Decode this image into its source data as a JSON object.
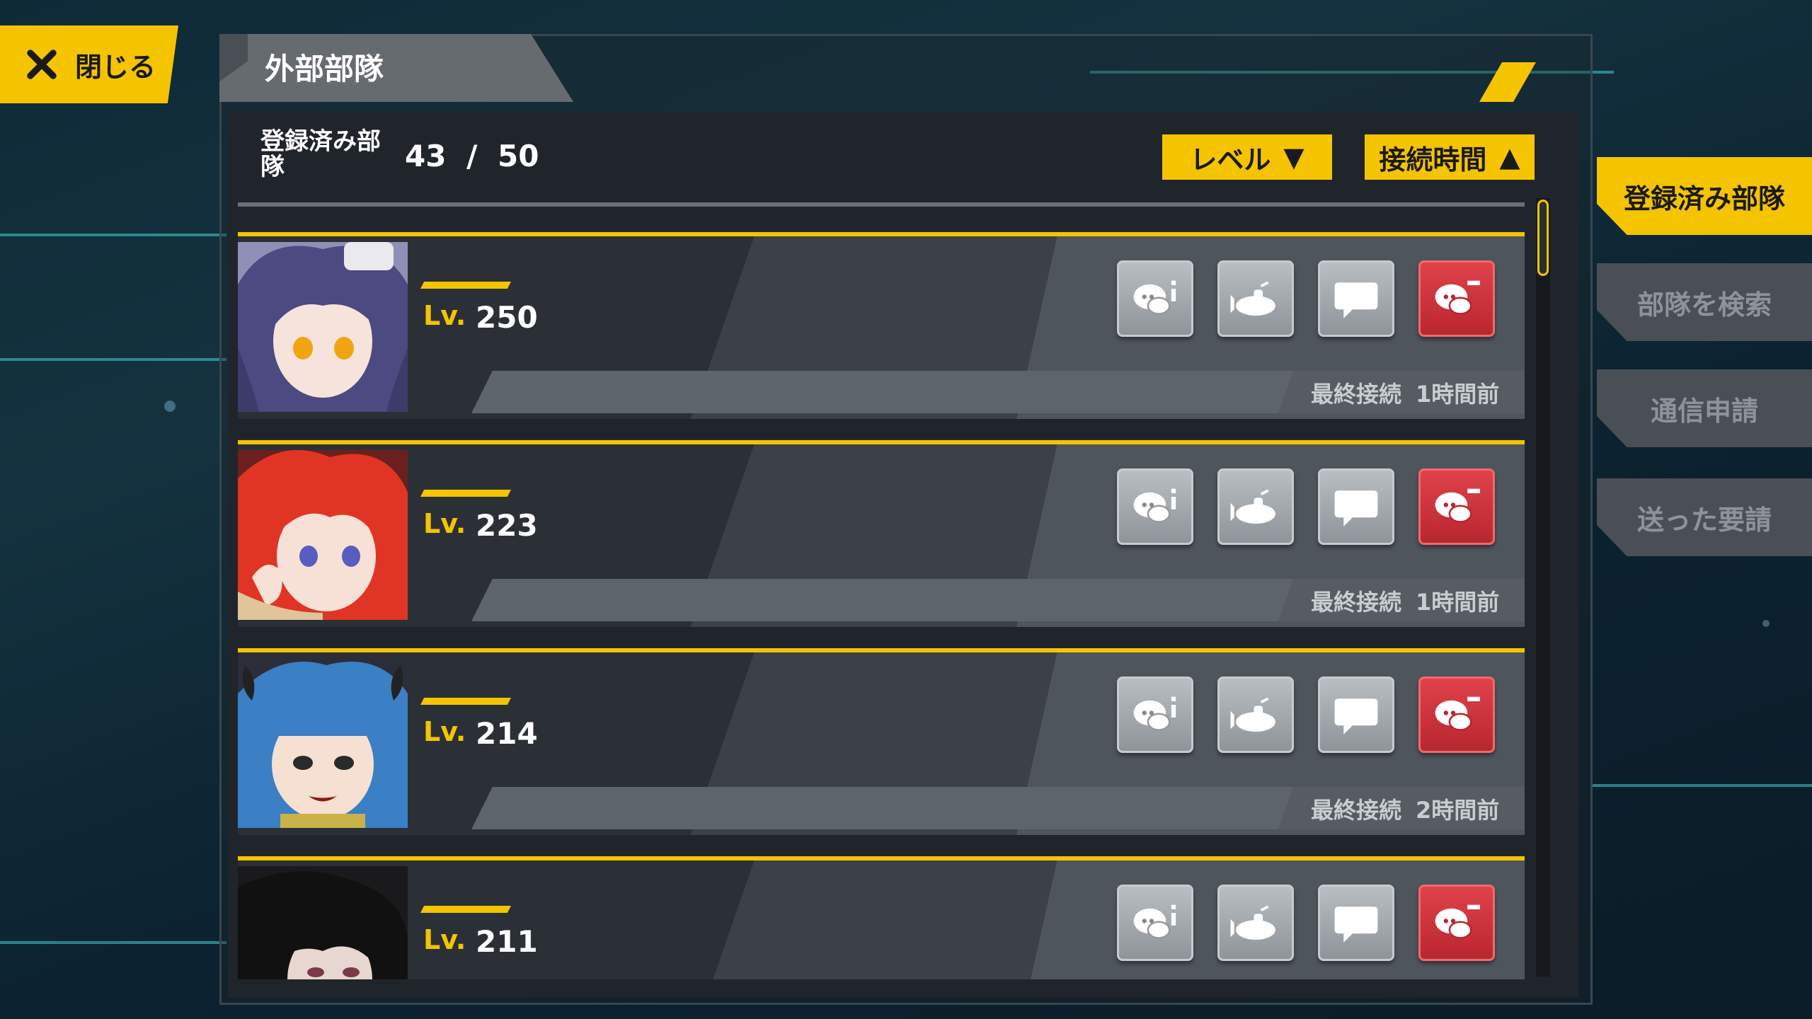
{
  "close_button": {
    "label": "閉じる"
  },
  "panel": {
    "title": "外部部隊"
  },
  "header": {
    "registered_label": "登録済み部隊",
    "registered_count": "43",
    "separator": "/",
    "registered_max": "50",
    "sort_level": "レベル",
    "sort_level_arrow": "▼",
    "sort_time": "接続時間",
    "sort_time_arrow": "▲"
  },
  "rows": [
    {
      "level_label": "Lv.",
      "level": "250",
      "last_login_label": "最終接続",
      "last_login_time": "1時間前",
      "portrait": "purple-hair-maid"
    },
    {
      "level_label": "Lv.",
      "level": "223",
      "last_login_label": "最終接続",
      "last_login_time": "1時間前",
      "portrait": "red-hair"
    },
    {
      "level_label": "Lv.",
      "level": "214",
      "last_login_label": "最終接続",
      "last_login_time": "2時間前",
      "portrait": "blue-hair-horns"
    },
    {
      "level_label": "Lv.",
      "level": "211",
      "last_login_label": "",
      "last_login_time": "",
      "portrait": "black-hair"
    }
  ],
  "actions": [
    "chat-info-icon",
    "submarine-icon",
    "message-icon",
    "remove-friend-icon"
  ],
  "side_tabs": [
    {
      "label": "登録済み部隊",
      "active": true
    },
    {
      "label": "部隊を検索",
      "active": false
    },
    {
      "label": "通信申請",
      "active": false
    },
    {
      "label": "送った要請",
      "active": false
    }
  ],
  "colors": {
    "accent": "#f5c400",
    "danger": "#d0323b",
    "panel": "#2b3037"
  }
}
